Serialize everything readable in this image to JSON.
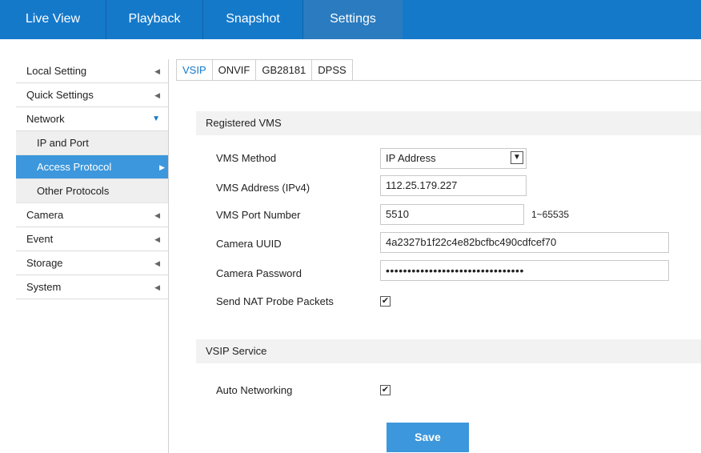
{
  "topnav": {
    "items": [
      {
        "label": "Live View"
      },
      {
        "label": "Playback"
      },
      {
        "label": "Snapshot"
      },
      {
        "label": "Settings"
      }
    ]
  },
  "sidebar": {
    "items": [
      {
        "label": "Local Setting"
      },
      {
        "label": "Quick Settings"
      },
      {
        "label": "Network"
      },
      {
        "label": "IP and Port"
      },
      {
        "label": "Access Protocol"
      },
      {
        "label": "Other Protocols"
      },
      {
        "label": "Camera"
      },
      {
        "label": "Event"
      },
      {
        "label": "Storage"
      },
      {
        "label": "System"
      }
    ]
  },
  "tabs": [
    {
      "label": "VSIP"
    },
    {
      "label": "ONVIF"
    },
    {
      "label": "GB28181"
    },
    {
      "label": "DPSS"
    }
  ],
  "registered_vms": {
    "header": "Registered VMS",
    "method_label": "VMS Method",
    "method_value": "IP Address",
    "address_label": "VMS Address (IPv4)",
    "address_value": "112.25.179.227",
    "port_label": "VMS Port Number",
    "port_value": "5510",
    "port_hint": "1~65535",
    "uuid_label": "Camera UUID",
    "uuid_value": "4a2327b1f22c4e82bcfbc490cdfcef70",
    "password_label": "Camera Password",
    "password_value": "••••••••••••••••••••••••••••••••",
    "nat_label": "Send NAT Probe Packets",
    "nat_checked": true
  },
  "vsip_service": {
    "header": "VSIP Service",
    "auto_label": "Auto Networking",
    "auto_checked": true
  },
  "save_label": "Save",
  "colors": {
    "accent": "#1579ca",
    "active_item": "#3c97dc"
  }
}
